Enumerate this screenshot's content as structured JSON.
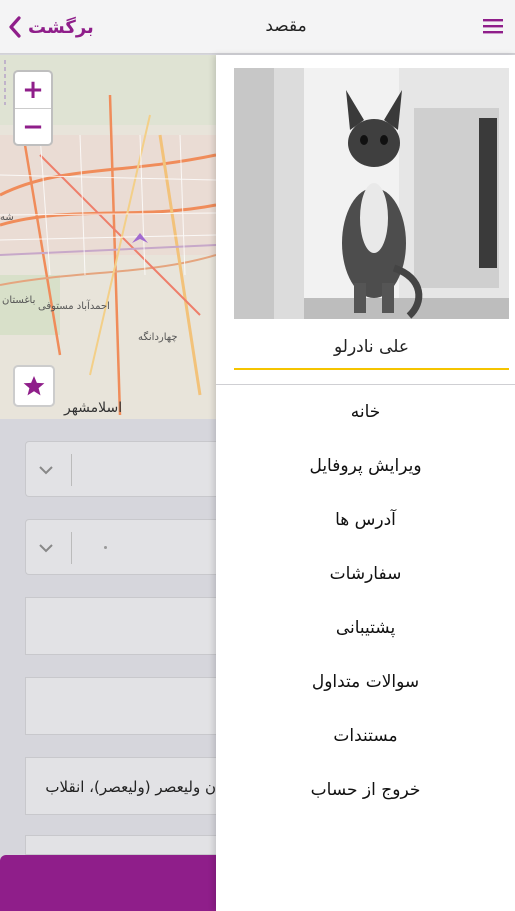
{
  "header": {
    "back_label": "برگشت",
    "title": "مقصد",
    "back_icon": "chevron-left-icon",
    "menu_icon": "hamburger-menu-icon"
  },
  "map": {
    "zoom_in": "+",
    "zoom_out": "−",
    "labels": {
      "shahr": "شه",
      "baghestan": "باغستان",
      "ahmadabad": "احمدآباد مستوفی",
      "chahardangeh": "چهاردانگه",
      "eslamshahr": "اسلامشهر"
    },
    "favorite_icon": "star-icon"
  },
  "form": {
    "address_line": "ن ولیعصر (ولیعصر)، انقلاب"
  },
  "drawer": {
    "user_name": "علی نادرلو",
    "menu_items": [
      "خانه",
      "ویرایش پروفایل",
      "آدرس ها",
      "سفارشات",
      "پشتیبانی",
      "سوالات متداول",
      "مستندات",
      "خروج از حساب"
    ]
  },
  "colors": {
    "accent": "#8f1e8a",
    "underline": "#f5c400"
  }
}
